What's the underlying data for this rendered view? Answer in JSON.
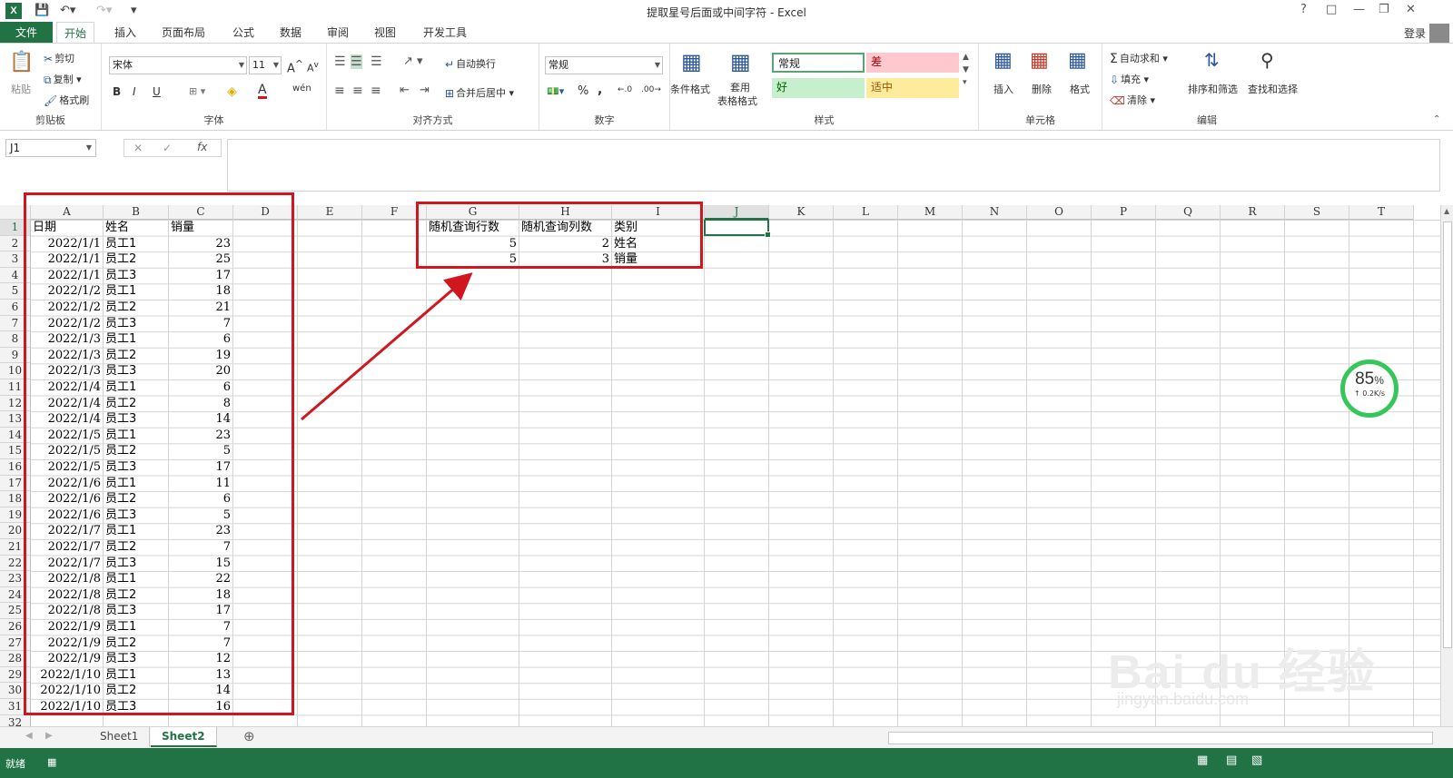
{
  "window": {
    "title": "提取星号后面或中间字符 - Excel",
    "app_icon": "X",
    "login": "登录"
  },
  "ribbon_tabs": [
    {
      "label": "文件"
    },
    {
      "label": "开始"
    },
    {
      "label": "插入"
    },
    {
      "label": "页面布局"
    },
    {
      "label": "公式"
    },
    {
      "label": "数据"
    },
    {
      "label": "审阅"
    },
    {
      "label": "视图"
    },
    {
      "label": "开发工具"
    }
  ],
  "clipboard": {
    "paste": "粘贴",
    "cut": "剪切",
    "copy": "复制",
    "format_painter": "格式刷",
    "group": "剪贴板"
  },
  "font": {
    "name": "宋体",
    "size": "11",
    "group": "字体",
    "bold": "B",
    "italic": "I",
    "underline": "U",
    "font_color": "A"
  },
  "alignment": {
    "wrap": "自动换行",
    "merge": "合并后居中",
    "group": "对齐方式"
  },
  "number": {
    "format": "常规",
    "percent": "%",
    "comma": ",",
    "group": "数字"
  },
  "styles": {
    "conditional": "条件格式",
    "table_fmt_1": "套用",
    "table_fmt_2": "表格格式",
    "normal": "常规",
    "bad": "差",
    "good": "好",
    "neutral": "适中",
    "group": "样式",
    "colors": {
      "normal_border": "#5aa373",
      "bad_bg": "#ffc7ce",
      "good_bg": "#c6efce",
      "neutral_bg": "#ffeb9c"
    }
  },
  "cells": {
    "insert": "插入",
    "delete": "删除",
    "format": "格式",
    "group": "单元格"
  },
  "editing": {
    "autosum": "自动求和",
    "fill": "填充",
    "clear": "清除",
    "sort": "排序和筛选",
    "find": "查找和选择",
    "group": "编辑"
  },
  "formula_bar": {
    "name_box": "J1",
    "fx": "fx",
    "content": ""
  },
  "columns": [
    "A",
    "B",
    "C",
    "D",
    "E",
    "F",
    "G",
    "H",
    "I",
    "J",
    "K",
    "L",
    "M",
    "N",
    "O",
    "P",
    "Q",
    "R",
    "S",
    "T"
  ],
  "selected_cell": "J1",
  "sheet": {
    "headers": [
      "日期",
      "姓名",
      "销量"
    ],
    "rows": [
      [
        "2022/1/1",
        "员工1",
        "23"
      ],
      [
        "2022/1/1",
        "员工2",
        "25"
      ],
      [
        "2022/1/1",
        "员工3",
        "17"
      ],
      [
        "2022/1/2",
        "员工1",
        "18"
      ],
      [
        "2022/1/2",
        "员工2",
        "21"
      ],
      [
        "2022/1/2",
        "员工3",
        "7"
      ],
      [
        "2022/1/3",
        "员工1",
        "6"
      ],
      [
        "2022/1/3",
        "员工2",
        "19"
      ],
      [
        "2022/1/3",
        "员工3",
        "20"
      ],
      [
        "2022/1/4",
        "员工1",
        "6"
      ],
      [
        "2022/1/4",
        "员工2",
        "8"
      ],
      [
        "2022/1/4",
        "员工3",
        "14"
      ],
      [
        "2022/1/5",
        "员工1",
        "23"
      ],
      [
        "2022/1/5",
        "员工2",
        "5"
      ],
      [
        "2022/1/5",
        "员工3",
        "17"
      ],
      [
        "2022/1/6",
        "员工1",
        "11"
      ],
      [
        "2022/1/6",
        "员工2",
        "6"
      ],
      [
        "2022/1/6",
        "员工3",
        "5"
      ],
      [
        "2022/1/7",
        "员工1",
        "23"
      ],
      [
        "2022/1/7",
        "员工2",
        "7"
      ],
      [
        "2022/1/7",
        "员工3",
        "15"
      ],
      [
        "2022/1/8",
        "员工1",
        "22"
      ],
      [
        "2022/1/8",
        "员工2",
        "18"
      ],
      [
        "2022/1/8",
        "员工3",
        "17"
      ],
      [
        "2022/1/9",
        "员工1",
        "7"
      ],
      [
        "2022/1/9",
        "员工2",
        "7"
      ],
      [
        "2022/1/9",
        "员工3",
        "12"
      ],
      [
        "2022/1/10",
        "员工1",
        "13"
      ],
      [
        "2022/1/10",
        "员工2",
        "14"
      ],
      [
        "2022/1/10",
        "员工3",
        "16"
      ]
    ],
    "lookup": {
      "headers": [
        "随机查询行数",
        "随机查询列数",
        "类别"
      ],
      "rows": [
        [
          "5",
          "2",
          "姓名"
        ],
        [
          "5",
          "3",
          "销量"
        ]
      ]
    }
  },
  "sheet_tabs": [
    {
      "label": "Sheet1"
    },
    {
      "label": "Sheet2",
      "active": true
    }
  ],
  "status": {
    "ready": "就绪"
  },
  "net_widget": {
    "percent": "85",
    "unit": "%",
    "speed": "↑ 0.2K/s"
  },
  "watermark": {
    "main": "Bai du 经验",
    "url": "jingyan.baidu.com"
  }
}
